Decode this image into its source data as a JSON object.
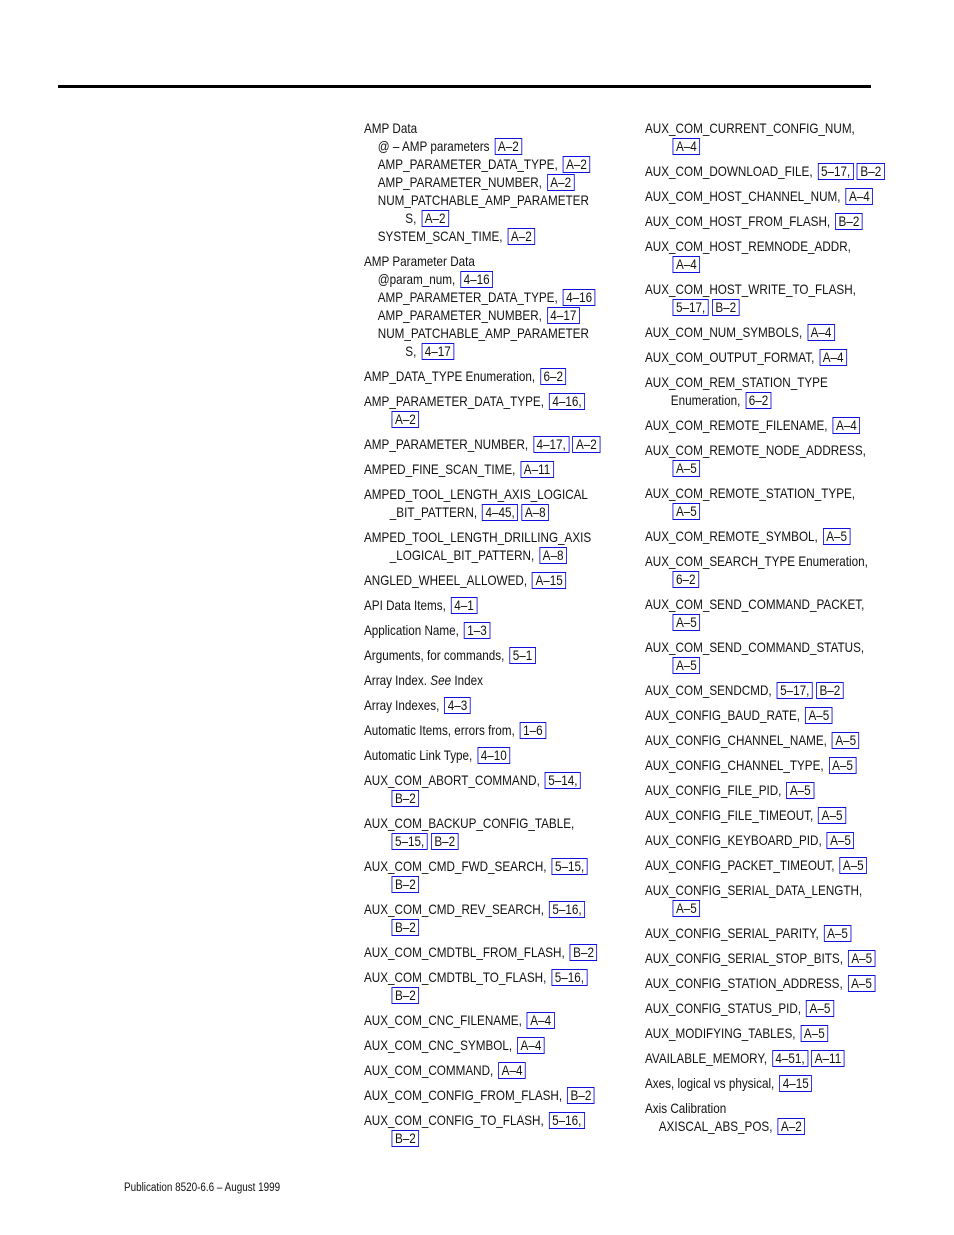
{
  "footer": {
    "publication": "Publication 8520-6.6 – August 1999"
  },
  "left_column": [
    {
      "term": "AMP Data",
      "refs": [],
      "subs": [
        {
          "term": "@ – AMP parameters",
          "refs": [
            "A–2"
          ]
        },
        {
          "term": "AMP_PARAMETER_DATA_TYPE,",
          "refs": [
            "A–2"
          ]
        },
        {
          "term": "AMP_PARAMETER_NUMBER,",
          "refs": [
            "A–2"
          ]
        },
        {
          "term": "NUM_PATCHABLE_AMP_PARAMETER",
          "cont": "S,",
          "refs": [
            "A–2"
          ]
        },
        {
          "term": "SYSTEM_SCAN_TIME,",
          "refs": [
            "A–2"
          ]
        }
      ]
    },
    {
      "term": "AMP Parameter Data",
      "refs": [],
      "subs": [
        {
          "term": "@param_num,",
          "refs": [
            "4–16"
          ]
        },
        {
          "term": "AMP_PARAMETER_DATA_TYPE,",
          "refs": [
            "4–16"
          ]
        },
        {
          "term": "AMP_PARAMETER_NUMBER,",
          "refs": [
            "4–17"
          ]
        },
        {
          "term": "NUM_PATCHABLE_AMP_PARAMETER",
          "cont": "S,",
          "refs": [
            "4–17"
          ]
        }
      ]
    },
    {
      "term": "AMP_DATA_TYPE Enumeration,",
      "refs": [
        "6–2"
      ]
    },
    {
      "term": "AMP_PARAMETER_DATA_TYPE,",
      "refs": [
        "4–16,"
      ],
      "cont_refs": [
        "A–2"
      ]
    },
    {
      "term": "AMP_PARAMETER_NUMBER,",
      "refs": [
        "4–17,",
        "A–2"
      ]
    },
    {
      "term": "AMPED_FINE_SCAN_TIME,",
      "refs": [
        "A–11"
      ]
    },
    {
      "term": "AMPED_TOOL_LENGTH_AXIS_LOGICAL",
      "cont": "_BIT_PATTERN,",
      "refs": [
        "4–45,",
        "A–8"
      ]
    },
    {
      "term": "AMPED_TOOL_LENGTH_DRILLING_AXIS",
      "cont": "_LOGICAL_BIT_PATTERN,",
      "refs": [
        "A–8"
      ]
    },
    {
      "term": "ANGLED_WHEEL_ALLOWED,",
      "refs": [
        "A–15"
      ]
    },
    {
      "term": "API Data Items,",
      "refs": [
        "4–1"
      ]
    },
    {
      "term": "Application Name,",
      "refs": [
        "1–3"
      ]
    },
    {
      "term": "Arguments, for commands,",
      "refs": [
        "5–1"
      ]
    },
    {
      "term": "Array Index.",
      "see": "See",
      "see_target": "Index",
      "refs": []
    },
    {
      "term": "Array Indexes,",
      "refs": [
        "4–3"
      ]
    },
    {
      "term": "Automatic Items, errors from,",
      "refs": [
        "1–6"
      ]
    },
    {
      "term": "Automatic Link Type,",
      "refs": [
        "4–10"
      ]
    },
    {
      "term": "AUX_COM_ABORT_COMMAND,",
      "refs": [
        "5–14,"
      ],
      "cont_refs": [
        "B–2"
      ]
    },
    {
      "term": "AUX_COM_BACKUP_CONFIG_TABLE,",
      "refs": [],
      "cont_refs": [
        "5–15,",
        "B–2"
      ]
    },
    {
      "term": "AUX_COM_CMD_FWD_SEARCH,",
      "refs": [
        "5–15,"
      ],
      "cont_refs": [
        "B–2"
      ]
    },
    {
      "term": "AUX_COM_CMD_REV_SEARCH,",
      "refs": [
        "5–16,"
      ],
      "cont_refs": [
        "B–2"
      ]
    },
    {
      "term": "AUX_COM_CMDTBL_FROM_FLASH,",
      "refs": [
        "B–2"
      ]
    },
    {
      "term": "AUX_COM_CMDTBL_TO_FLASH,",
      "refs": [
        "5–16,"
      ],
      "cont_refs": [
        "B–2"
      ]
    },
    {
      "term": "AUX_COM_CNC_FILENAME,",
      "refs": [
        "A–4"
      ]
    },
    {
      "term": "AUX_COM_CNC_SYMBOL,",
      "refs": [
        "A–4"
      ]
    },
    {
      "term": "AUX_COM_COMMAND,",
      "refs": [
        "A–4"
      ]
    },
    {
      "term": "AUX_COM_CONFIG_FROM_FLASH,",
      "refs": [
        "B–2"
      ]
    },
    {
      "term": "AUX_COM_CONFIG_TO_FLASH,",
      "refs": [
        "5–16,"
      ],
      "cont_refs": [
        "B–2"
      ]
    }
  ],
  "right_column": [
    {
      "term": "AUX_COM_CURRENT_CONFIG_NUM,",
      "refs": [],
      "cont_refs": [
        "A–4"
      ]
    },
    {
      "term": "AUX_COM_DOWNLOAD_FILE,",
      "refs": [
        "5–17,",
        "B–2"
      ]
    },
    {
      "term": "AUX_COM_HOST_CHANNEL_NUM,",
      "refs": [
        "A–4"
      ]
    },
    {
      "term": "AUX_COM_HOST_FROM_FLASH,",
      "refs": [
        "B–2"
      ]
    },
    {
      "term": "AUX_COM_HOST_REMNODE_ADDR,",
      "refs": [],
      "cont_refs": [
        "A–4"
      ]
    },
    {
      "term": "AUX_COM_HOST_WRITE_TO_FLASH,",
      "refs": [],
      "cont_refs": [
        "5–17,",
        "B–2"
      ]
    },
    {
      "term": "AUX_COM_NUM_SYMBOLS,",
      "refs": [
        "A–4"
      ]
    },
    {
      "term": "AUX_COM_OUTPUT_FORMAT,",
      "refs": [
        "A–4"
      ]
    },
    {
      "term": "AUX_COM_REM_STATION_TYPE",
      "cont": "Enumeration,",
      "refs": [
        "6–2"
      ]
    },
    {
      "term": "AUX_COM_REMOTE_FILENAME,",
      "refs": [
        "A–4"
      ]
    },
    {
      "term": "AUX_COM_REMOTE_NODE_ADDRESS,",
      "refs": [],
      "cont_refs": [
        "A–5"
      ]
    },
    {
      "term": "AUX_COM_REMOTE_STATION_TYPE,",
      "refs": [],
      "cont_refs": [
        "A–5"
      ]
    },
    {
      "term": "AUX_COM_REMOTE_SYMBOL,",
      "refs": [
        "A–5"
      ]
    },
    {
      "term": "AUX_COM_SEARCH_TYPE  Enumeration,",
      "refs": [],
      "cont_refs": [
        "6–2"
      ]
    },
    {
      "term": "AUX_COM_SEND_COMMAND_PACKET,",
      "refs": [],
      "cont_refs": [
        "A–5"
      ]
    },
    {
      "term": "AUX_COM_SEND_COMMAND_STATUS,",
      "refs": [],
      "cont_refs": [
        "A–5"
      ]
    },
    {
      "term": "AUX_COM_SENDCMD,",
      "refs": [
        "5–17,",
        "B–2"
      ]
    },
    {
      "term": "AUX_CONFIG_BAUD_RATE,",
      "refs": [
        "A–5"
      ]
    },
    {
      "term": "AUX_CONFIG_CHANNEL_NAME,",
      "refs": [
        "A–5"
      ]
    },
    {
      "term": "AUX_CONFIG_CHANNEL_TYPE,",
      "refs": [
        "A–5"
      ]
    },
    {
      "term": "AUX_CONFIG_FILE_PID,",
      "refs": [
        "A–5"
      ]
    },
    {
      "term": "AUX_CONFIG_FILE_TIMEOUT,",
      "refs": [
        "A–5"
      ]
    },
    {
      "term": "AUX_CONFIG_KEYBOARD_PID,",
      "refs": [
        "A–5"
      ]
    },
    {
      "term": "AUX_CONFIG_PACKET_TIMEOUT,",
      "refs": [
        "A–5"
      ]
    },
    {
      "term": "AUX_CONFIG_SERIAL_DATA_LENGTH,",
      "refs": [],
      "cont_refs": [
        "A–5"
      ]
    },
    {
      "term": "AUX_CONFIG_SERIAL_PARITY,",
      "refs": [
        "A–5"
      ]
    },
    {
      "term": "AUX_CONFIG_SERIAL_STOP_BITS,",
      "refs": [
        "A–5"
      ]
    },
    {
      "term": "AUX_CONFIG_STATION_ADDRESS,",
      "refs": [
        "A–5"
      ]
    },
    {
      "term": "AUX_CONFIG_STATUS_PID,",
      "refs": [
        "A–5"
      ]
    },
    {
      "term": "AUX_MODIFYING_TABLES,",
      "refs": [
        "A–5"
      ]
    },
    {
      "term": "AVAILABLE_MEMORY,",
      "refs": [
        "4–51,",
        "A–11"
      ]
    },
    {
      "term": "Axes, logical vs physical,",
      "refs": [
        "4–15"
      ]
    },
    {
      "term": "Axis Calibration",
      "refs": [],
      "subs": [
        {
          "term": "AXISCAL_ABS_POS,",
          "refs": [
            "A–2"
          ]
        }
      ]
    }
  ]
}
